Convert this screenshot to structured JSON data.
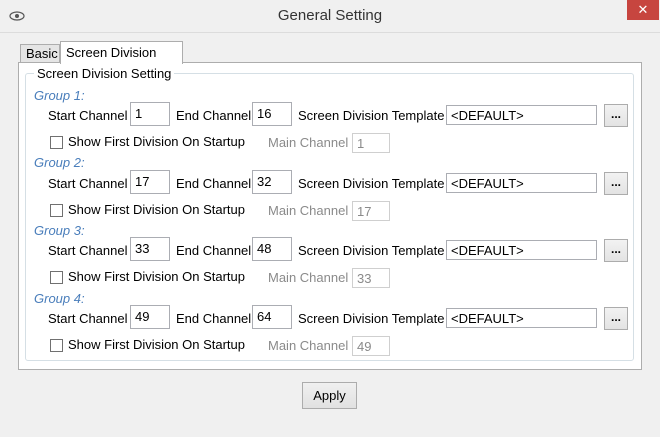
{
  "window": {
    "title": "General Setting",
    "close_glyph": "✕"
  },
  "tabs": [
    {
      "label": "Basic"
    },
    {
      "label": "Screen Division"
    }
  ],
  "section": {
    "title": "Screen Division Setting"
  },
  "labels": {
    "start_channel": "Start Channel",
    "end_channel": "End Channel",
    "template": "Screen Division Template",
    "show_first": "Show First Division On Startup",
    "main_channel": "Main Channel",
    "browse": "..."
  },
  "groups": [
    {
      "label": "Group 1:",
      "start": "1",
      "end": "16",
      "template": "<DEFAULT>",
      "main": "1"
    },
    {
      "label": "Group 2:",
      "start": "17",
      "end": "32",
      "template": "<DEFAULT>",
      "main": "17"
    },
    {
      "label": "Group 3:",
      "start": "33",
      "end": "48",
      "template": "<DEFAULT>",
      "main": "33"
    },
    {
      "label": "Group 4:",
      "start": "49",
      "end": "64",
      "template": "<DEFAULT>",
      "main": "49"
    }
  ],
  "apply_label": "Apply"
}
